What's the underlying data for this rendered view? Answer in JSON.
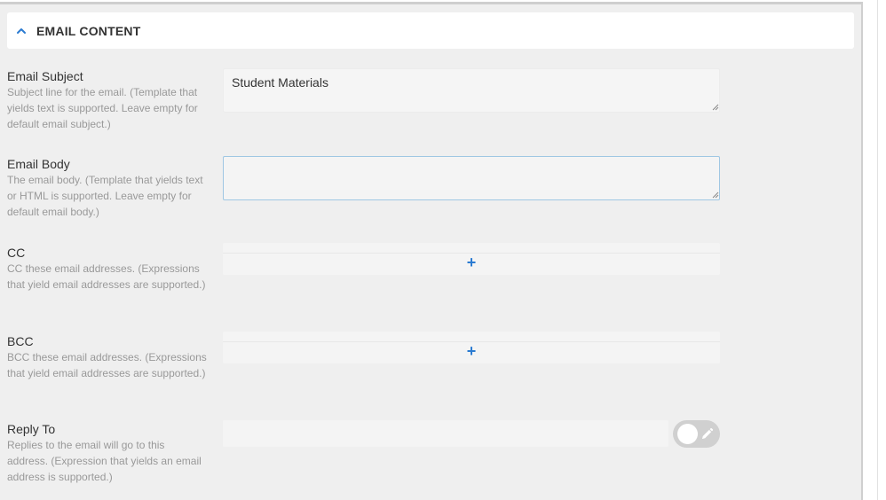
{
  "section": {
    "title": "EMAIL CONTENT",
    "chevron_icon": "chevron-up-icon"
  },
  "fields": {
    "subject": {
      "label": "Email Subject",
      "description": "Subject line for the email. (Template that yields text is supported. Leave empty for default email subject.)",
      "value": "Student Materials"
    },
    "body": {
      "label": "Email Body",
      "description": "The email body. (Template that yields text or HTML is supported. Leave empty for default email body.)",
      "value": ""
    },
    "cc": {
      "label": "CC",
      "description": "CC these email addresses. (Expressions that yield email addresses are supported.)",
      "add_symbol": "+"
    },
    "bcc": {
      "label": "BCC",
      "description": "BCC these email addresses. (Expressions that yield email addresses are supported.)",
      "add_symbol": "+"
    },
    "reply_to": {
      "label": "Reply To",
      "description": "Replies to the email will go to this address. (Expression that yields an email address is supported.)",
      "value": "",
      "toggle_icon": "pencil-icon"
    }
  },
  "colors": {
    "accent": "#2b7bd1",
    "focus_border": "#9fc7e3",
    "panel_bg": "#efefef"
  }
}
